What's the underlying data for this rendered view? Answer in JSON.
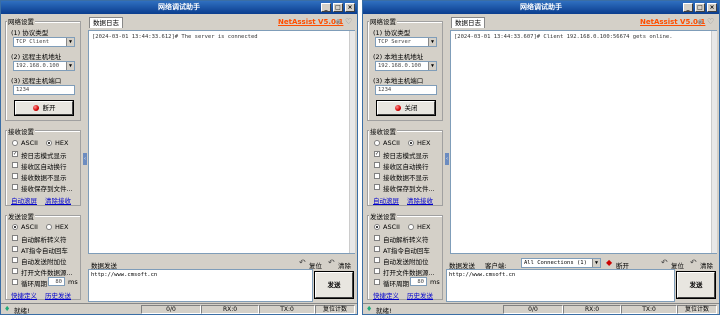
{
  "left": {
    "title": "网络调试助手",
    "brand": "NetAssist V5.0.1",
    "net_settings": {
      "group_title": "网络设置",
      "protocol_label": "(1) 协议类型",
      "protocol_value": "TCP Client",
      "host_label": "(2) 远程主机地址",
      "host_value": "192.168.0.100",
      "port_label": "(3) 远程主机端口",
      "port_value": "1234",
      "connect_button": "断开"
    },
    "recv_settings": {
      "group_title": "接收设置",
      "ascii": "ASCII",
      "hex": "HEX",
      "opt1": "按日志模式显示",
      "opt2": "接收区自动换行",
      "opt3": "接收数据不显示",
      "opt4": "接收保存到文件...",
      "link_autoscroll": "自动滚屏",
      "link_clear": "清除接收"
    },
    "send_settings": {
      "group_title": "发送设置",
      "ascii": "ASCII",
      "hex": "HEX",
      "opt1": "自动解析转义符",
      "opt2": "AT指令自动回车",
      "opt3": "自动发送附加位",
      "opt4": "打开文件数据源...",
      "opt5": "循环周期",
      "period_value": "80",
      "period_unit": "ms",
      "link_shortcut": "快捷定义",
      "link_history": "历史发送"
    },
    "log_tab": "数据日志",
    "log_line": "[2024-03-01 13:44:33.612]# The server is connected",
    "send_tab": "数据发送",
    "reset_label": "复位",
    "clear_label": "清除",
    "send_text": "http://www.cmsoft.cn",
    "send_button": "发送",
    "status": {
      "ready": "就绪!",
      "rx": "0/0",
      "rx_count": "RX:0",
      "tx_count": "TX:0",
      "reset_count": "复位计数"
    }
  },
  "right": {
    "title": "网络调试助手",
    "brand": "NetAssist V5.0.1",
    "net_settings": {
      "group_title": "网络设置",
      "protocol_label": "(1) 协议类型",
      "protocol_value": "TCP Server",
      "host_label": "(2) 本地主机地址",
      "host_value": "192.168.0.100",
      "port_label": "(3) 本地主机端口",
      "port_value": "1234",
      "connect_button": "关闭"
    },
    "recv_settings": {
      "group_title": "接收设置",
      "ascii": "ASCII",
      "hex": "HEX",
      "opt1": "按日志模式显示",
      "opt2": "接收区自动换行",
      "opt3": "接收数据不显示",
      "opt4": "接收保存到文件...",
      "link_autoscroll": "自动滚屏",
      "link_clear": "清除接收"
    },
    "send_settings": {
      "group_title": "发送设置",
      "ascii": "ASCII",
      "hex": "HEX",
      "opt1": "自动解析转义符",
      "opt2": "AT指令自动回车",
      "opt3": "自动发送附加位",
      "opt4": "打开文件数据源...",
      "opt5": "循环周期",
      "period_value": "80",
      "period_unit": "ms",
      "link_shortcut": "快捷定义",
      "link_history": "历史发送"
    },
    "log_tab": "数据日志",
    "log_line": "[2024-03-01 13:44:33.607]# Client 192.168.0.100:56674 gets online.",
    "send_tab": "数据发送",
    "client_label": "客户端:",
    "client_value": "All Connections (1)",
    "disconnect_button": "断开",
    "reset_label": "复位",
    "clear_label": "清除",
    "send_text": "http://www.cmsoft.cn",
    "send_button": "发送",
    "status": {
      "ready": "就绪!",
      "rx": "0/0",
      "rx_count": "RX:0",
      "tx_count": "TX:0",
      "reset_count": "复位计数"
    }
  }
}
